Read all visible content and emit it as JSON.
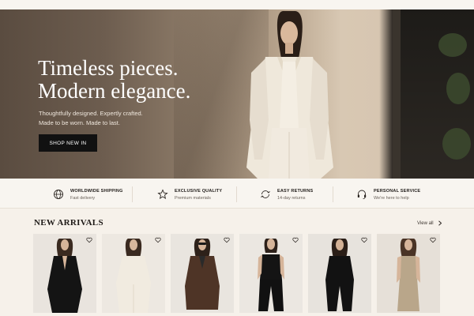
{
  "hero": {
    "title_line1": "Timeless pieces.",
    "title_line2": "Modern elegance.",
    "subtitle_line1": "Thoughtfully designed. Expertly crafted.",
    "subtitle_line2": "Made to be worn. Made to last.",
    "cta_label": "SHOP NEW IN"
  },
  "features": [
    {
      "title": "WORLDWIDE SHIPPING",
      "subtitle": "Fast delivery",
      "icon": "globe-icon"
    },
    {
      "title": "EXCLUSIVE QUALITY",
      "subtitle": "Premium materials",
      "icon": "star-badge-icon"
    },
    {
      "title": "EASY RETURNS",
      "subtitle": "14-day returns",
      "icon": "return-arrows-icon"
    },
    {
      "title": "PERSONAL SERVICE",
      "subtitle": "We're here to help",
      "icon": "headset-icon"
    }
  ],
  "new_arrivals": {
    "title": "NEW ARRIVALS",
    "view_all_label": "View all",
    "products": [
      {
        "outfit": "black blazer suit",
        "bg": "#e9e4de"
      },
      {
        "outfit": "cream satin set",
        "bg": "#ede8e1"
      },
      {
        "outfit": "brown long coat",
        "bg": "#e9e5df"
      },
      {
        "outfit": "black vest and trousers",
        "bg": "#ebe7e1"
      },
      {
        "outfit": "black jumpsuit",
        "bg": "#e7e3dd"
      },
      {
        "outfit": "champagne slip dress",
        "bg": "#e6e0d8"
      }
    ]
  },
  "colors": {
    "accent": "#111111",
    "background": "#f6f1ea"
  }
}
